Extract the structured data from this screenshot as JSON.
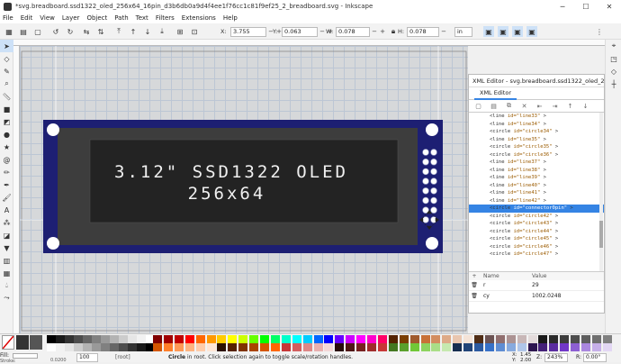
{
  "window": {
    "title": "*svg.breadboard.ssd1322_oled_256x64_16pin_d3b6db0a9d4f4ee1f76cc1c81f9ef25_2_breadboard.svg - Inkscape",
    "minimize": "─",
    "maximize": "☐",
    "close": "✕"
  },
  "menu": [
    "File",
    "Edit",
    "View",
    "Layer",
    "Object",
    "Path",
    "Text",
    "Filters",
    "Extensions",
    "Help"
  ],
  "toolbar": {
    "x_label": "X:",
    "x_value": "3.755",
    "y_label": "Y:",
    "y_value": "0.063",
    "w_label": "W:",
    "w_value": "0.078",
    "h_label": "H:",
    "h_value": "0.078",
    "unit": "in"
  },
  "canvas": {
    "oled_line1": "3.12\" SSD1322 OLED",
    "oled_line2": "256x64"
  },
  "xml_editor": {
    "window_title": "XML Editor - svg.breadboard.ssd1322_oled_256x64_16pin",
    "tab": "XML Editor",
    "nodes": [
      {
        "tag": "<line",
        "attr": " id=\"line33\"",
        "tail": " >"
      },
      {
        "tag": "<line",
        "attr": " id=\"line34\"",
        "tail": " >"
      },
      {
        "tag": "<circle",
        "attr": " id=\"circle34\"",
        "tail": " >"
      },
      {
        "tag": "<line",
        "attr": " id=\"line35\"",
        "tail": " >"
      },
      {
        "tag": "<circle",
        "attr": " id=\"circle35\"",
        "tail": " >"
      },
      {
        "tag": "<circle",
        "attr": " id=\"circle36\"",
        "tail": " >"
      },
      {
        "tag": "<line",
        "attr": " id=\"line37\"",
        "tail": " >"
      },
      {
        "tag": "<line",
        "attr": " id=\"line38\"",
        "tail": " >"
      },
      {
        "tag": "<line",
        "attr": " id=\"line39\"",
        "tail": " >"
      },
      {
        "tag": "<line",
        "attr": " id=\"line40\"",
        "tail": " >"
      },
      {
        "tag": "<line",
        "attr": " id=\"line41\"",
        "tail": " >"
      },
      {
        "tag": "<line",
        "attr": " id=\"line42\"",
        "tail": " >"
      },
      {
        "tag": "<circle",
        "attr": " id=\"connector0pin\"",
        "tail": " >",
        "selected": true
      },
      {
        "tag": "<circle",
        "attr": " id=\"circle42\"",
        "tail": " >"
      },
      {
        "tag": "<circle",
        "attr": " id=\"circle43\"",
        "tail": " >"
      },
      {
        "tag": "<circle",
        "attr": " id=\"circle44\"",
        "tail": " >"
      },
      {
        "tag": "<circle",
        "attr": " id=\"circle45\"",
        "tail": " >"
      },
      {
        "tag": "<circle",
        "attr": " id=\"circle46\"",
        "tail": " >"
      },
      {
        "tag": "<circle",
        "attr": " id=\"circle47\"",
        "tail": " >"
      }
    ],
    "attr_header_name": "Name",
    "attr_header_value": "Value",
    "attrs": [
      {
        "name": "r",
        "value": "29"
      },
      {
        "name": "cy",
        "value": "1002.0248"
      }
    ]
  },
  "status": {
    "fill_label": "Fill:",
    "stroke_label": "Stroke:",
    "stroke_value": "0.0200",
    "opacity": "100",
    "layer": "[root]",
    "message_bold": "Circle",
    "message": " in root. Click selection again to toggle scale/rotation handles.",
    "x_label": "X:",
    "x_value": "1.45",
    "y_label": "Y:",
    "y_value": "2.00",
    "zoom_label": "Z:",
    "zoom_value": "243%",
    "rot_label": "R:",
    "rot_value": "0.00°"
  }
}
